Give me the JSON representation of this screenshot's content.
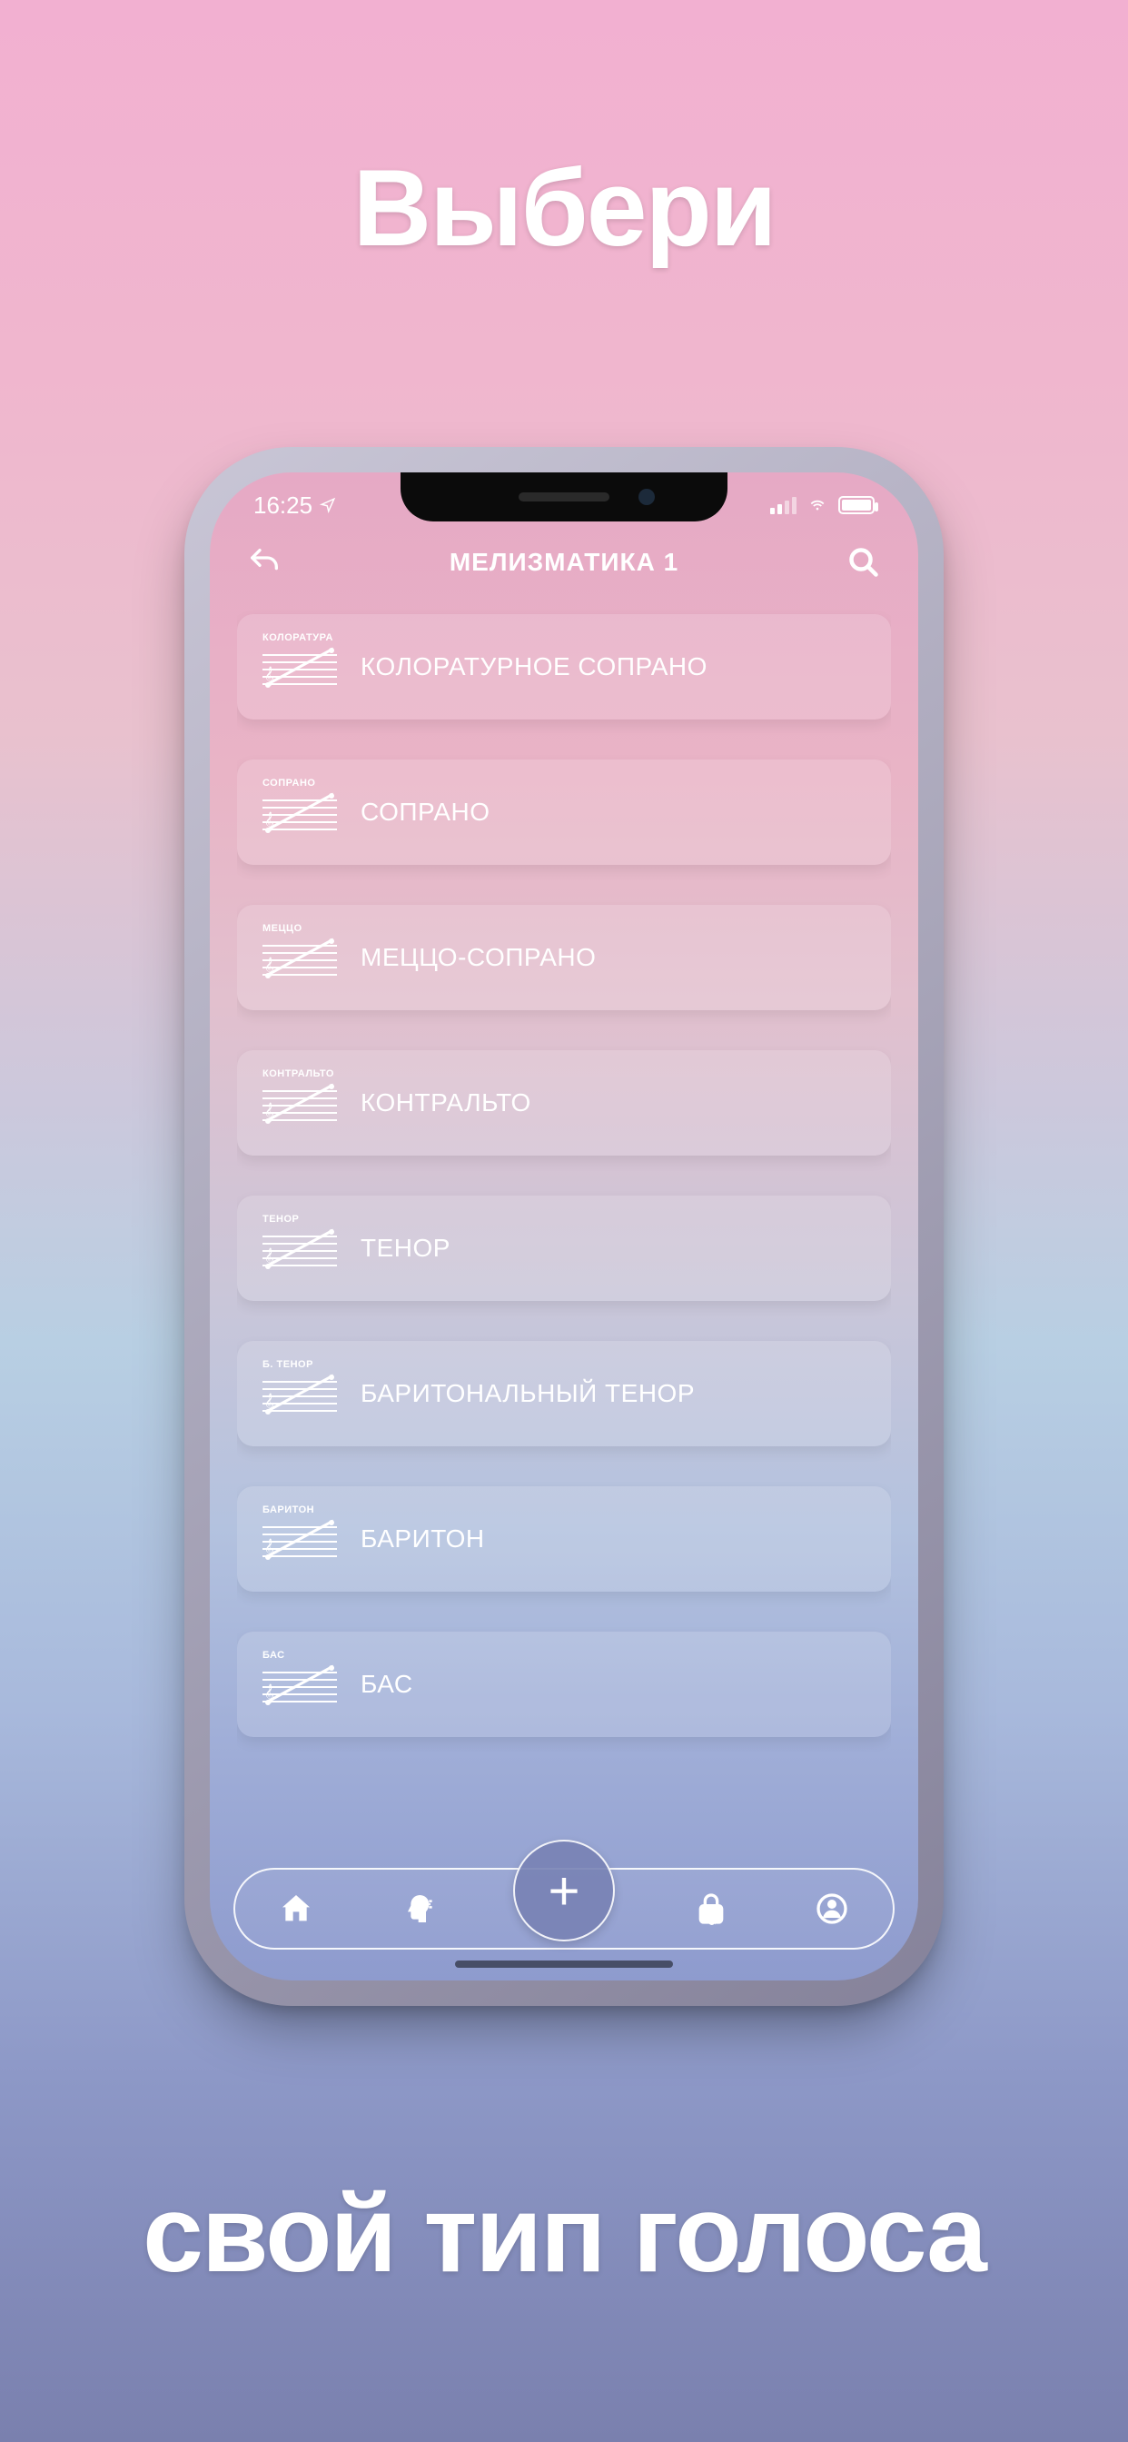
{
  "promo": {
    "top": "Выбери",
    "bottom": "свой тип голоса"
  },
  "statusbar": {
    "time": "16:25"
  },
  "topbar": {
    "title": "МЕЛИЗМАТИКА 1"
  },
  "voices": [
    {
      "mini": "КОЛОРАТУРА",
      "label": "КОЛОРАТУРНОЕ СОПРАНО"
    },
    {
      "mini": "СОПРАНО",
      "label": "СОПРАНО"
    },
    {
      "mini": "МЕЦЦО",
      "label": "МЕЦЦО-СОПРАНО"
    },
    {
      "mini": "КОНТРАЛЬТО",
      "label": "КОНТРАЛЬТО"
    },
    {
      "mini": "ТЕНОР",
      "label": "ТЕНОР"
    },
    {
      "mini": "Б. ТЕНОР",
      "label": "БАРИТОНАЛЬНЫЙ ТЕНОР"
    },
    {
      "mini": "БАРИТОН",
      "label": "БАРИТОН"
    },
    {
      "mini": "БАС",
      "label": "БАС"
    }
  ],
  "tabbar": {
    "plus": "+"
  }
}
